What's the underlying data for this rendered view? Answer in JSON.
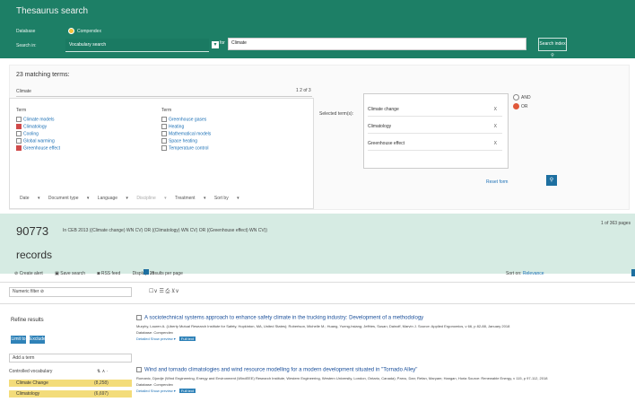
{
  "header": {
    "title": "Thesaurus search",
    "database_label": "Database",
    "database_value": "Compendex",
    "search_in_label": "Search in:",
    "search_in_value": "Vocabulary search",
    "for_label": "for",
    "term_value": "Climate",
    "search_index_btn": "Search index"
  },
  "matching": {
    "count_text": "23 matching terms:",
    "heading": "Climate",
    "page_info": "1 2 of 3",
    "col1_header": "Term",
    "col2_header": "Term",
    "col1_terms": [
      {
        "label": "Climate models",
        "checked": false
      },
      {
        "label": "Climatology",
        "checked": true
      },
      {
        "label": "Cooling",
        "checked": false
      },
      {
        "label": "Global warming",
        "checked": false
      },
      {
        "label": "Greenhouse effect",
        "checked": true
      }
    ],
    "col2_terms": [
      {
        "label": "Greenhouse gases",
        "checked": false
      },
      {
        "label": "Heating",
        "checked": false
      },
      {
        "label": "Mathematical models",
        "checked": false
      },
      {
        "label": "Space heating",
        "checked": false
      },
      {
        "label": "Temperature control",
        "checked": false
      }
    ]
  },
  "selected": {
    "label": "Selected term(s):",
    "terms": [
      "Climate change",
      "Climatology",
      "Greenhouse effect"
    ],
    "remove_label": "X",
    "op_and": "AND",
    "op_or": "OR",
    "reset": "Reset form"
  },
  "filters": [
    "Date",
    "Document type",
    "Language",
    "Discipline",
    "Treatment",
    "Sort by"
  ],
  "results": {
    "count": "90773",
    "records_label": "records",
    "query": "In CEB 2013 ((Climate change) WN CV) OR ((Climatology) WN CV) OR ((Greenhouse effect) WN CV))",
    "pages": "1 of 363 pages",
    "create_alert": "Create alert",
    "save_search": "Save search",
    "rss": "RSS feed",
    "display": "Display: 25",
    "results_per_page": "results per page",
    "sort_by": "Sort on:",
    "sort_value": "Relevance"
  },
  "refine": {
    "filter_placeholder": "Numeric filter",
    "heading": "Refine results",
    "limit_to": "Limit to",
    "exclude": "Exclude",
    "add_term": "Add a term",
    "controlled": "Controlled vocabulary",
    "rows": [
      {
        "label": "Climate Change",
        "count": "(8,258)"
      },
      {
        "label": "Climatology",
        "count": "(6,697)"
      }
    ]
  },
  "records": [
    {
      "title": "A sociotechnical systems approach to enhance safety climate in the trucking industry: Development of a methodology",
      "authors": "Murphy, Lauren A. (Liberty Mutual Research Institute for Safety, Hopkinton, MA, United States); Robertson, Michelle M.; Huang, Yueng-hsiang; Jeffries, Susan; Dainoff, Marvin J. Source: Applied Ergonomics, v 66, p 82-88, January 2018",
      "meta": "Database: Compendex",
      "detail": "Detailed   Show preview",
      "fulltext": "Full text"
    },
    {
      "title": "Wind and tornado climatologies and wind resource modelling for a modern development situated in \"Tornado Alley\"",
      "authors": "Romanic, Djordje (Wind Engineering, Energy and Environment (WindEEE) Research Institute, Western Engineering, Western University, London, Ontario, Canada); Parvu, Dan; Refan, Maryam; Hangan, Horia Source: Renewable Energy, v 115, p 97-112, 2018",
      "meta": "Database: Compendex",
      "detail": "Detailed   Show preview",
      "fulltext": "Full text"
    }
  ],
  "icons": {
    "dropdown": "chevron-down-icon",
    "search": "magnifier-icon"
  }
}
